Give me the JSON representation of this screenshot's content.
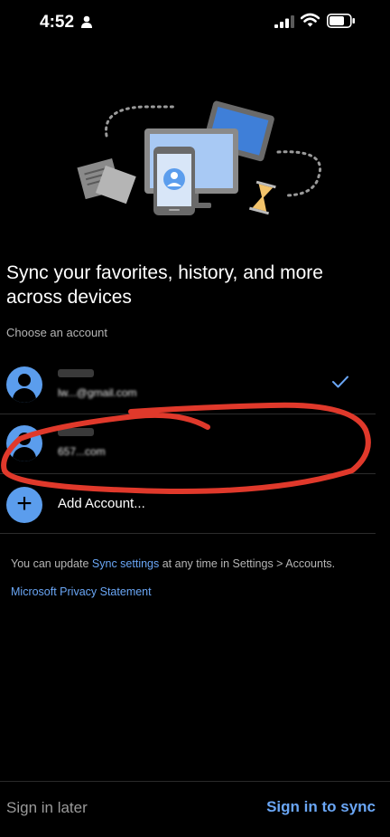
{
  "status_bar": {
    "time": "4:52",
    "icons": [
      "person-icon",
      "cellular-signal-icon",
      "wifi-icon",
      "battery-icon"
    ]
  },
  "hero": {
    "illustration": "sync-devices-illustration"
  },
  "headline": "Sync your favorites, history, and more across devices",
  "choose_label": "Choose an account",
  "accounts": [
    {
      "email": "lw...@gmail.com",
      "selected": true
    },
    {
      "email": "657...com",
      "selected": false
    }
  ],
  "add_account": {
    "label": "Add Account..."
  },
  "info": {
    "prefix": "You can update ",
    "sync_link": "Sync settings",
    "suffix": " at any time in Settings > Accounts.",
    "privacy_link": "Microsoft Privacy Statement"
  },
  "footer": {
    "sign_later": "Sign in later",
    "sign_in": "Sign in to sync"
  },
  "colors": {
    "background": "#000000",
    "accent": "#6aa6f5",
    "avatar": "#5b9ded",
    "annotation": "#e0392b"
  }
}
